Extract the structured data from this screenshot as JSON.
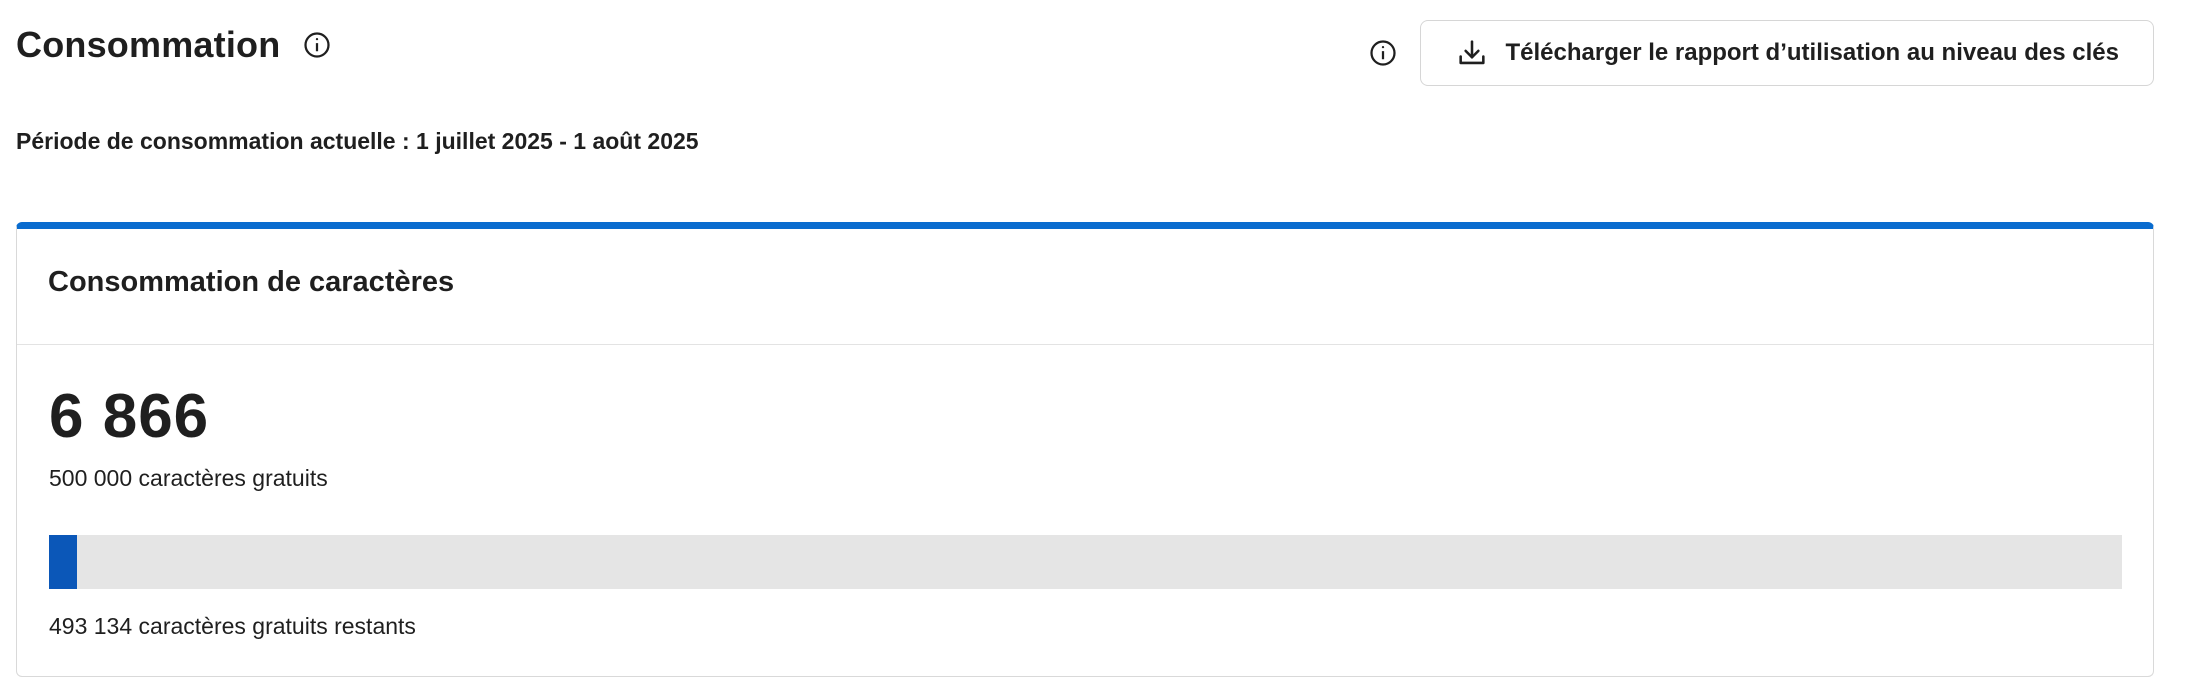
{
  "header": {
    "title": "Consommation",
    "title_info_icon": "info-icon",
    "report_info_icon": "info-icon",
    "download_button_label": "Télécharger le rapport d’utilisation au niveau des clés",
    "download_icon": "download-icon"
  },
  "period": {
    "text": "Période de consommation actuelle : 1 juillet 2025 - 1 août 2025"
  },
  "card": {
    "title": "Consommation de caractères",
    "usage_value": "6 866",
    "free_quota": "500 000 caractères gratuits",
    "remaining": "493 134 caractères gratuits restants",
    "progress_fraction": 0.01373,
    "accent_color": "#0a6ccf",
    "progress_color": "#0b57b8",
    "track_color": "#e5e5e5"
  }
}
